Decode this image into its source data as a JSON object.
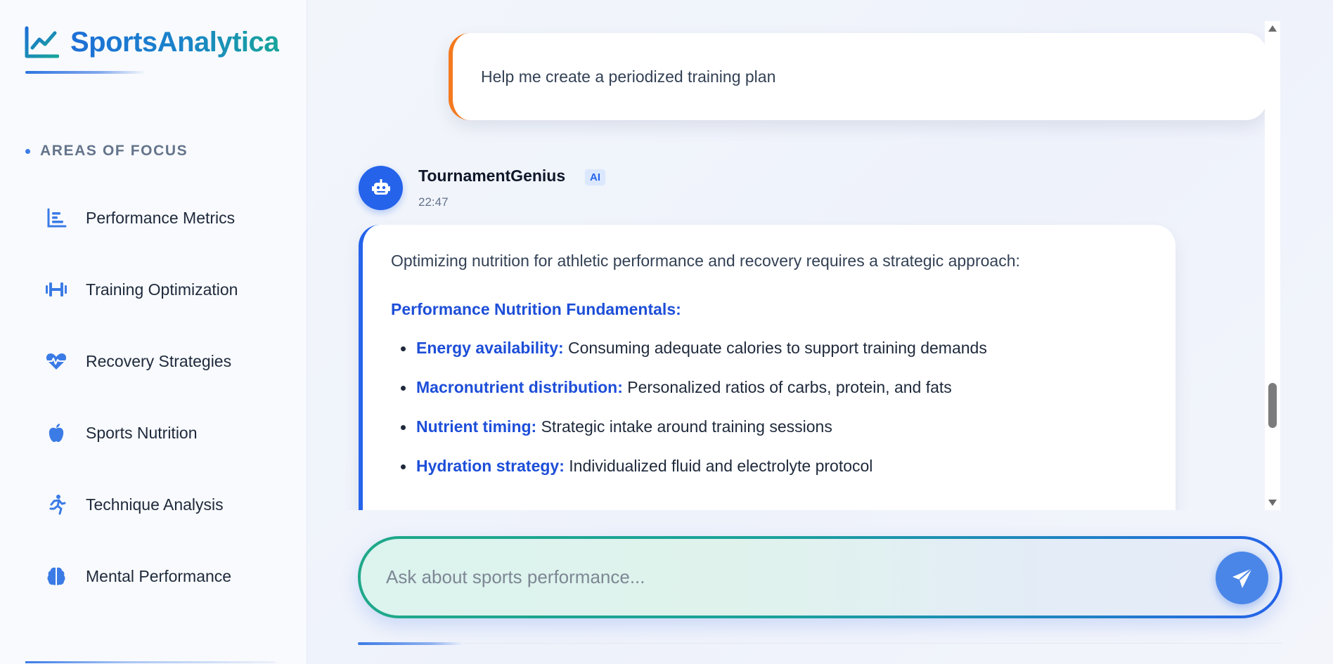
{
  "brand": {
    "name": "SportsAnalytica",
    "icon": "trend-line-icon"
  },
  "sidebar": {
    "section_label": "AREAS OF FOCUS",
    "items": [
      {
        "label": "Performance Metrics",
        "icon": "bar-chart-icon"
      },
      {
        "label": "Training Optimization",
        "icon": "dumbbell-icon"
      },
      {
        "label": "Recovery Strategies",
        "icon": "heart-pulse-icon"
      },
      {
        "label": "Sports Nutrition",
        "icon": "apple-icon"
      },
      {
        "label": "Technique Analysis",
        "icon": "running-person-icon"
      },
      {
        "label": "Mental Performance",
        "icon": "brain-icon"
      }
    ]
  },
  "chat": {
    "user_message": "Help me create a periodized training plan",
    "assistant": {
      "name": "TournamentGenius",
      "badge": "AI",
      "time": "22:47",
      "intro": "Optimizing nutrition for athletic performance and recovery requires a strategic approach:",
      "heading": "Performance Nutrition Fundamentals:",
      "points": [
        {
          "key": "Energy availability:",
          "text": " Consuming adequate calories to support training demands"
        },
        {
          "key": "Macronutrient distribution:",
          "text": " Personalized ratios of carbs, protein, and fats"
        },
        {
          "key": "Nutrient timing:",
          "text": " Strategic intake around training sessions"
        },
        {
          "key": "Hydration strategy:",
          "text": " Individualized fluid and electrolyte protocol"
        }
      ]
    }
  },
  "composer": {
    "placeholder": "Ask about sports performance...",
    "send_icon": "paper-plane-icon"
  },
  "colors": {
    "primary": "#2563eb",
    "teal": "#17a59a",
    "user_accent": "#f47a1f"
  }
}
